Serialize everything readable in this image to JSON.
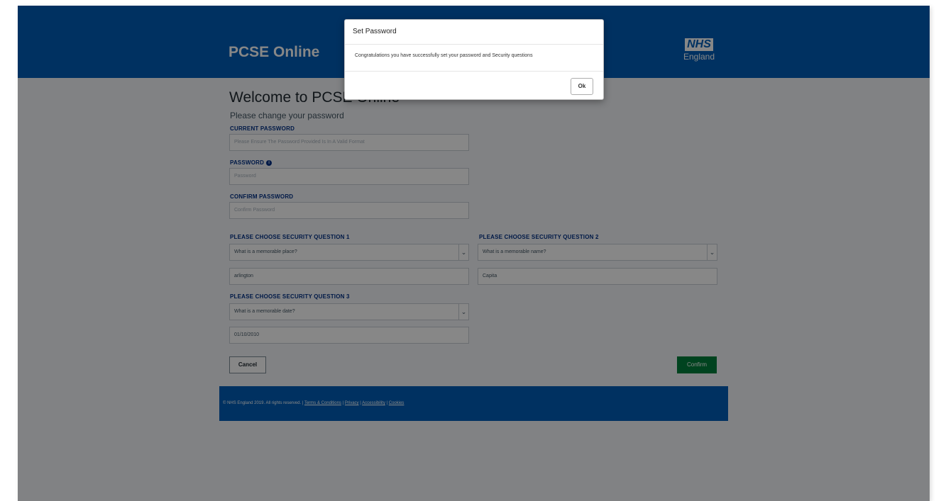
{
  "header": {
    "brand": "PCSE Online",
    "logo_nhs": "NHS",
    "logo_sub": "England"
  },
  "page": {
    "title": "Welcome to PCSE Online",
    "subtitle": "Please change your password"
  },
  "form": {
    "current_password": {
      "label": "CURRENT PASSWORD",
      "placeholder": "Please Ensure The Password Provided Is In A Valid Format"
    },
    "password": {
      "label": "PASSWORD",
      "placeholder": "Password",
      "info_icon": "info-icon"
    },
    "confirm_password": {
      "label": "CONFIRM PASSWORD",
      "placeholder": "Confirm Password"
    },
    "q1": {
      "label": "PLEASE CHOOSE SECURITY QUESTION 1",
      "selected": "What is a memorable place?",
      "answer": "arlington"
    },
    "q2": {
      "label": "PLEASE CHOOSE SECURITY QUESTION 2",
      "selected": "What is a memorable name?",
      "answer": "Capita"
    },
    "q3": {
      "label": "PLEASE CHOOSE SECURITY QUESTION 3",
      "selected": "What is a memorable date?",
      "answer": "01/10/2010"
    },
    "cancel_label": "Cancel",
    "confirm_label": "Confirm"
  },
  "footer": {
    "copyright": "© NHS England 2019. All rights reserved.",
    "sep": "|",
    "links": [
      "Terms & Conditions",
      "Privacy",
      "Accessibility",
      "Cookies"
    ]
  },
  "modal": {
    "title": "Set Password",
    "message": "Congratulations you have successfully set your password and Security questions",
    "ok_label": "Ok"
  },
  "colors": {
    "header_blue": "#005eb8",
    "confirm_green": "#007f3b",
    "label_blue": "#003087"
  }
}
